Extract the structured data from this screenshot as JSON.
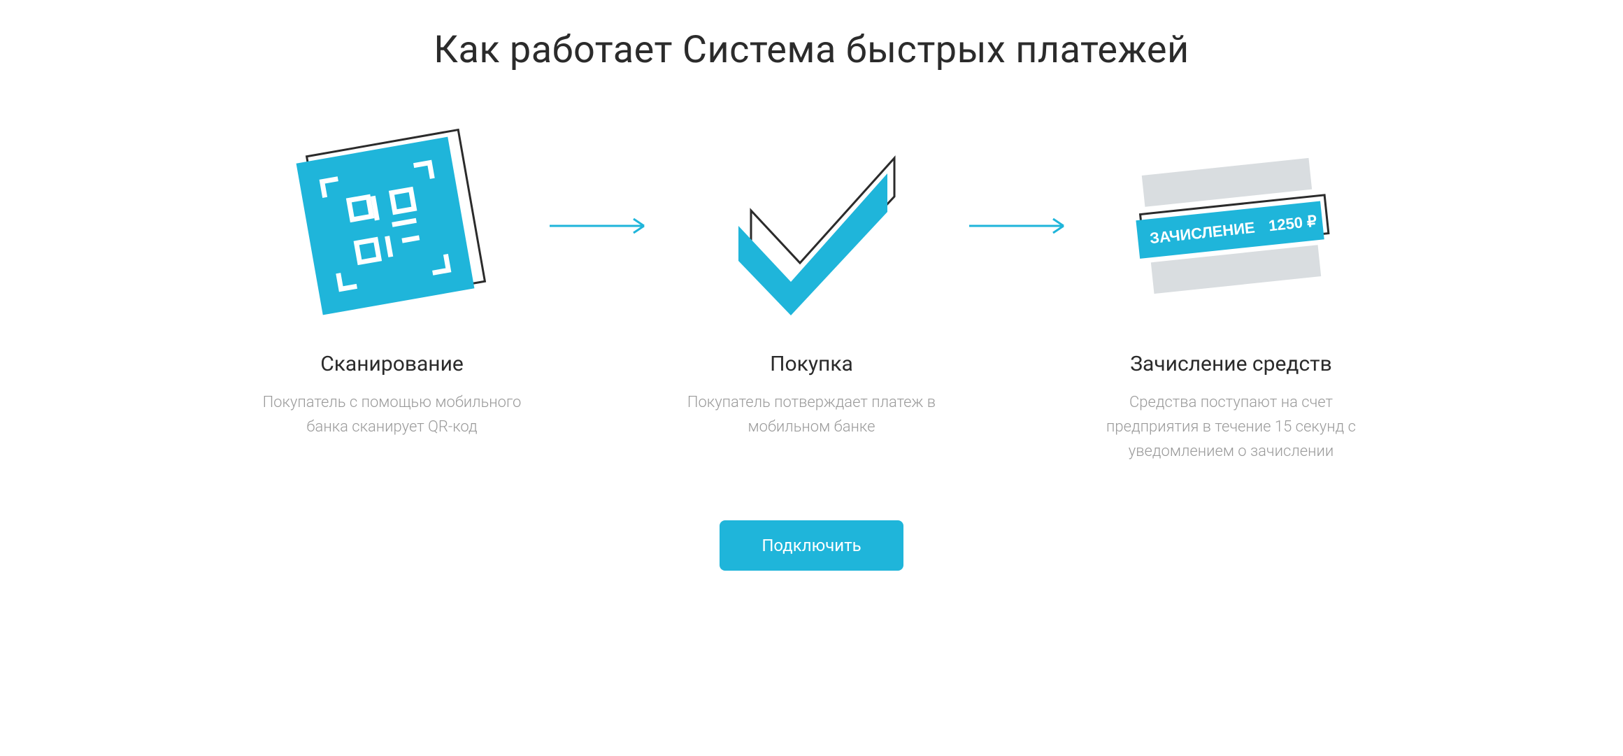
{
  "heading": "Как работает Система быстрых платежей",
  "steps": [
    {
      "title": "Сканирование",
      "desc": "Покупатель с помощью мобильного банка сканирует QR-код"
    },
    {
      "title": "Покупка",
      "desc": "Покупатель потверждает платеж в мобильном банке"
    },
    {
      "title": "Зачисление средств",
      "desc": "Средства поступают на счет предприятия в течение 15 секунд с уведомлением о зачислении"
    }
  ],
  "receipt": {
    "label": "ЗАЧИСЛЕНИЕ",
    "amount": "1250 ₽"
  },
  "cta": "Подключить",
  "colors": {
    "accent": "#1fb5da",
    "grey": "#d9dde0",
    "text": "#2b2b2b",
    "muted": "#9a9a9a"
  }
}
